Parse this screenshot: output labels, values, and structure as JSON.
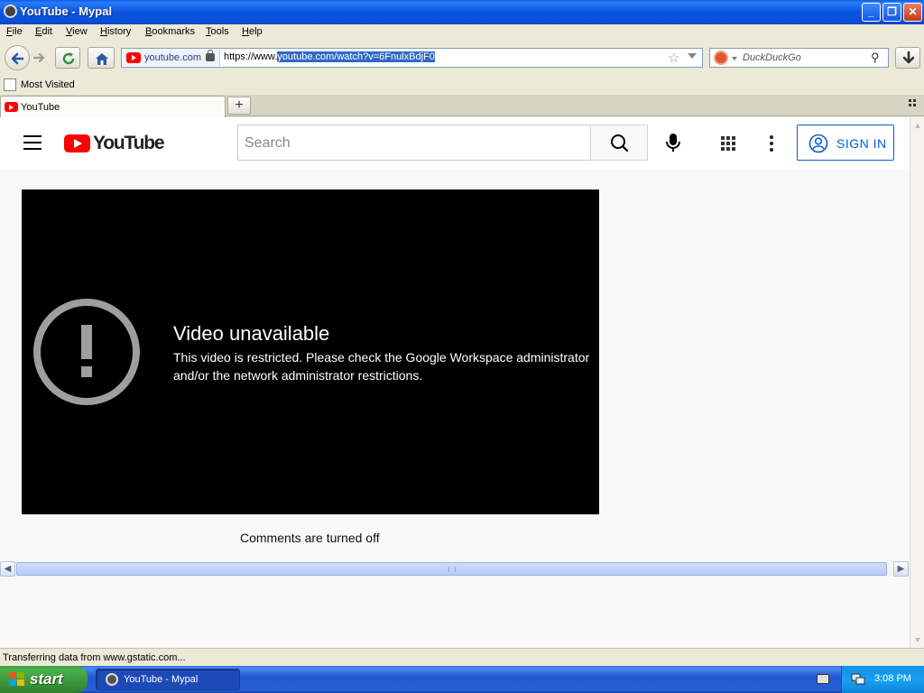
{
  "window": {
    "title": "YouTube - Mypal"
  },
  "menu": [
    "File",
    "Edit",
    "View",
    "History",
    "Bookmarks",
    "Tools",
    "Help"
  ],
  "address": {
    "identity_domain": "youtube.com",
    "url_prefix": "https://www.",
    "url_selected": "youtube.com/watch?v=6FnulxBdjF0"
  },
  "search": {
    "engine": "DuckDuckGo",
    "placeholder": "DuckDuckGo"
  },
  "bookmarks": {
    "most_visited": "Most Visited"
  },
  "tabs": [
    {
      "label": "YouTube"
    }
  ],
  "youtube": {
    "logo_text": "YouTube",
    "search_placeholder": "Search",
    "sign_in": "SIGN IN",
    "error_title": "Video unavailable",
    "error_message": "This video is restricted. Please check the Google Workspace administrator and/or the network administrator restrictions.",
    "comments": "Comments are turned off"
  },
  "status": {
    "text": "Transferring data from www.gstatic.com..."
  },
  "taskbar": {
    "start": "start",
    "task_label": "YouTube - Mypal",
    "clock": "3:08 PM"
  },
  "colors": {
    "youtube_red": "#ff0000",
    "signin_blue": "#065fd4",
    "xp_title_blue": "#0a5ce8",
    "start_green": "#3b963b"
  }
}
